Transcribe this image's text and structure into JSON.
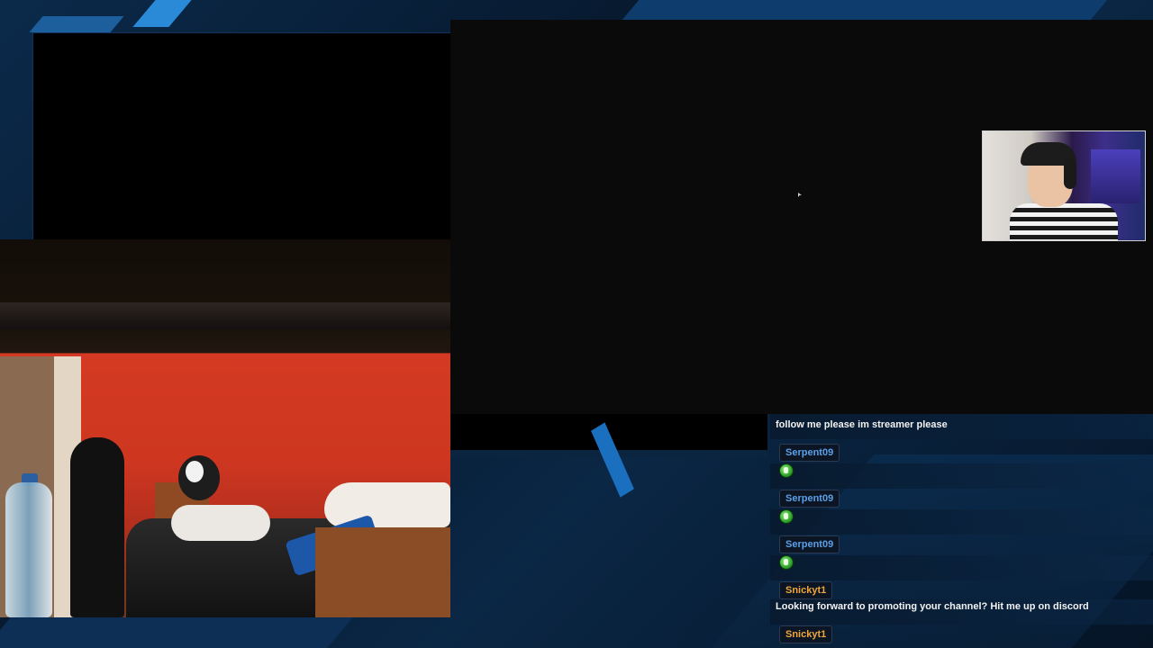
{
  "chat": {
    "messages": [
      {
        "text": "follow me please im streamer please"
      },
      {
        "user": "Serpent09",
        "emote": "green-emote"
      },
      {
        "user": "Serpent09",
        "emote": "green-emote"
      },
      {
        "user": "Serpent09",
        "emote": "green-emote"
      },
      {
        "user": "Snickyt1",
        "text": "Looking forward to promoting your channel? Hit me up on discord"
      },
      {
        "user": "Snickyt1"
      }
    ]
  },
  "colors": {
    "username_blue": "#5aa0e8",
    "username_orange": "#f0a63a",
    "background": "#06111f",
    "accent": "#1b6fbf"
  }
}
